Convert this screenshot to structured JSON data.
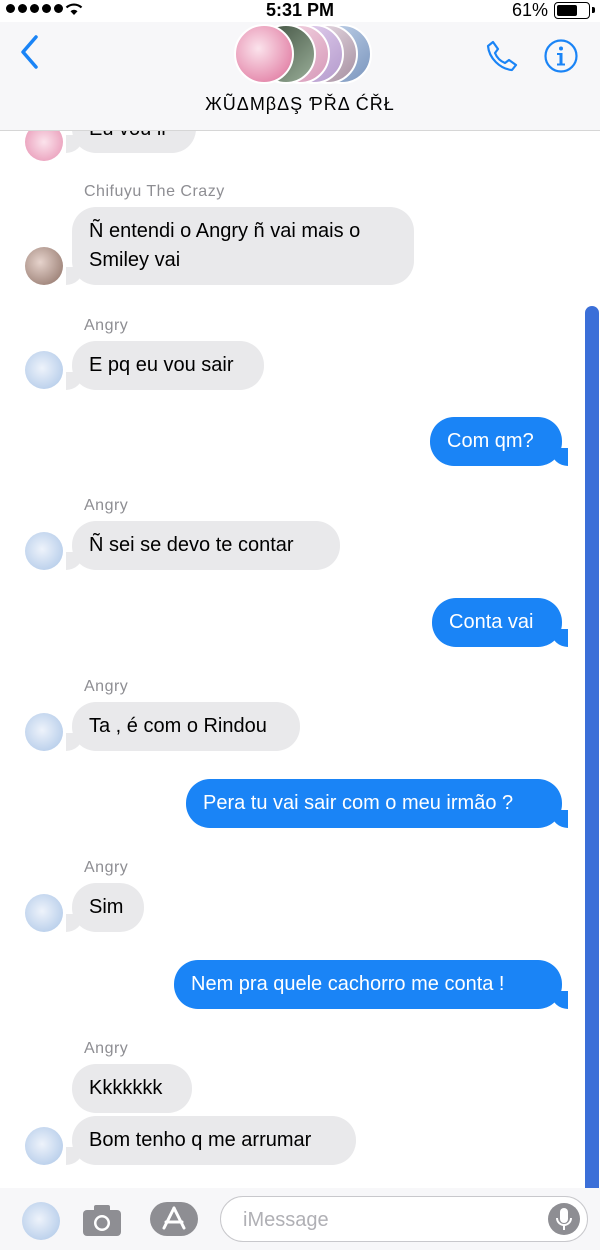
{
  "status_bar": {
    "time": "5:31 PM",
    "battery": "61%"
  },
  "header": {
    "group_name": "ЖŨΔMβΔŞ ƤŘΔ ĆŘŁ"
  },
  "messages": {
    "partial_top": "Eu vou ir",
    "m1_sender": "Chifuyu The Crazy",
    "m1_line1": "Ñ entendi o Angry ñ vai mais o",
    "m1_line2": "Smiley vai",
    "m2_sender": "Angry",
    "m2": "E pq eu vou sair",
    "m3": "Com qm?",
    "m4_sender": "Angry",
    "m4": "Ñ sei se devo te contar",
    "m5": "Conta vai",
    "m6_sender": "Angry",
    "m6": "Ta , é com o Rindou",
    "m7": "Pera tu vai sair com o meu irmão ?",
    "m8_sender": "Angry",
    "m8": "Sim",
    "m9": "Nem pra quele cachorro me conta !",
    "m10_sender": "Angry",
    "m10": "Kkkkkkk",
    "m11": "Bom tenho q me arrumar"
  },
  "input": {
    "placeholder": "iMessage"
  },
  "colors": {
    "outgoing": "#1a84f6",
    "incoming": "#e9e9eb",
    "accent": "#1a84f6"
  }
}
